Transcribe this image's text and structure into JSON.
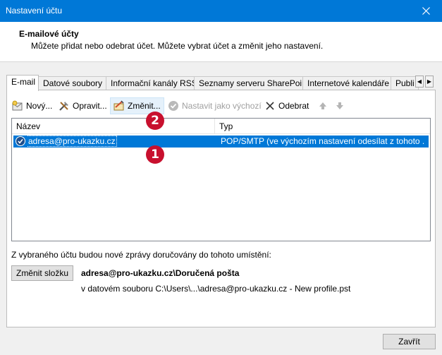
{
  "window": {
    "title": "Nastavení účtu"
  },
  "header": {
    "title": "E-mailové účty",
    "description": "Můžete přidat nebo odebrat účet. Můžete vybrat účet a změnit jeho nastavení."
  },
  "tabs": [
    {
      "label": "E-mail",
      "active": true
    },
    {
      "label": "Datové soubory",
      "active": false
    },
    {
      "label": "Informační kanály RSS",
      "active": false
    },
    {
      "label": "Seznamy serveru SharePoint",
      "active": false
    },
    {
      "label": "Internetové kalendáře",
      "active": false
    },
    {
      "label": "Publi",
      "active": false
    }
  ],
  "toolbar": {
    "new": "Nový...",
    "repair": "Opravit...",
    "change": "Změnit...",
    "set_default": "Nastavit jako výchozí",
    "remove": "Odebrat"
  },
  "list": {
    "columns": [
      "Název",
      "Typ"
    ],
    "rows": [
      {
        "name": "adresa@pro-ukazku.cz",
        "type": "POP/SMTP (ve výchozím nastavení odesílat z tohoto ...",
        "selected": true
      }
    ]
  },
  "badges": {
    "one": "1",
    "two": "2"
  },
  "delivery": {
    "label": "Z vybraného účtu budou nové zprávy doručovány do tohoto umístění:",
    "change_folder": "Změnit složku",
    "folder": "adresa@pro-ukazku.cz\\Doručená pošta",
    "file": "v datovém souboru C:\\Users\\...\\adresa@pro-ukazku.cz - New profile.pst"
  },
  "footer": {
    "close": "Zavřít"
  },
  "colors": {
    "accent": "#0078d7",
    "badge": "#c8102e"
  }
}
